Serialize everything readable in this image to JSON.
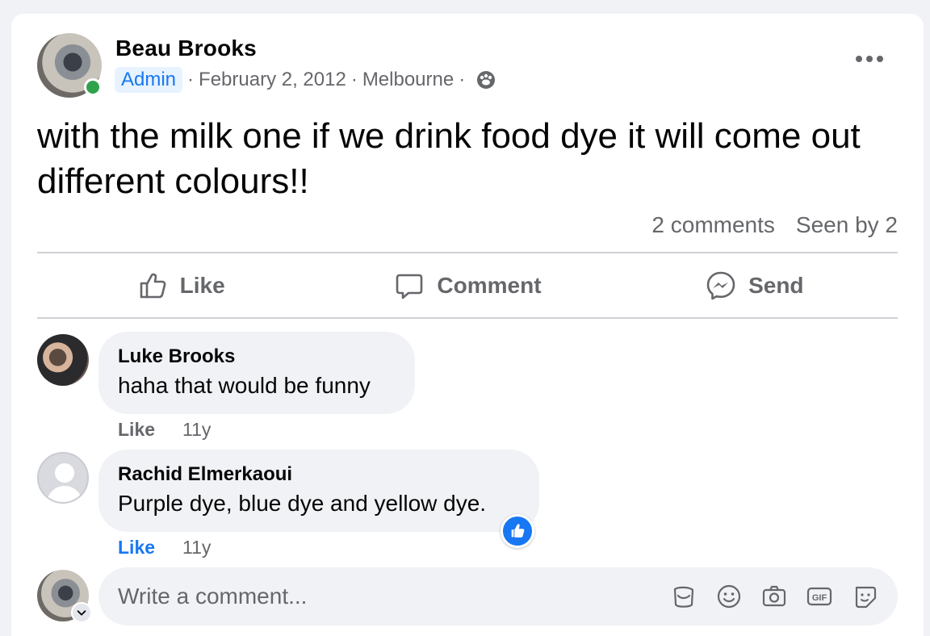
{
  "post": {
    "author": "Beau Brooks",
    "badge": "Admin",
    "date": "February 2, 2012",
    "location": "Melbourne",
    "separator": "·",
    "text": "with the milk one if we drink food dye it will come out different colours!!",
    "comments_count": "2 comments",
    "seen_by": "Seen by 2"
  },
  "actions": {
    "like": "Like",
    "comment": "Comment",
    "send": "Send"
  },
  "comments": [
    {
      "name": "Luke Brooks",
      "text": "haha that would be funny",
      "like": "Like",
      "time": "11y",
      "liked": false
    },
    {
      "name": "Rachid Elmerkaoui",
      "text": "Purple dye, blue dye and yellow dye.",
      "like": "Like",
      "time": "11y",
      "liked": true
    }
  ],
  "composer": {
    "placeholder": "Write a comment..."
  },
  "icons": [
    "more-icon",
    "group-privacy-icon",
    "like-icon",
    "comment-icon",
    "messenger-icon",
    "thumbs-up-icon",
    "sticker-icon",
    "emoji-icon",
    "camera-icon",
    "gif-icon",
    "avatar-sticker-icon",
    "chevron-down-icon"
  ],
  "colors": {
    "accent": "#1877f2",
    "online": "#31a24c",
    "muted_text": "#65676b",
    "bubble_bg": "#f0f2f5"
  }
}
